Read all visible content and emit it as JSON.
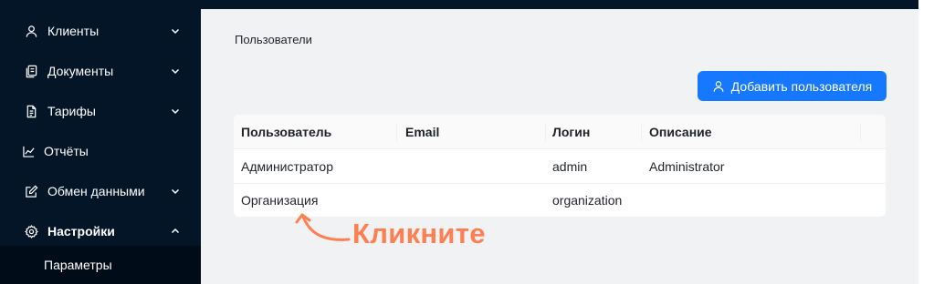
{
  "sidebar": {
    "items": [
      {
        "label": "Клиенты",
        "icon": "user-icon"
      },
      {
        "label": "Документы",
        "icon": "documents-icon"
      },
      {
        "label": "Тарифы",
        "icon": "tariff-icon"
      },
      {
        "label": "Отчёты",
        "icon": "chart-icon"
      },
      {
        "label": "Обмен данными",
        "icon": "edit-icon"
      },
      {
        "label": "Настройки",
        "icon": "gear-icon"
      }
    ],
    "sub_item": {
      "label": "Параметры"
    }
  },
  "page": {
    "title": "Пользователи",
    "add_button": "Добавить пользователя"
  },
  "table": {
    "columns": [
      "Пользователь",
      "Email",
      "Логин",
      "Описание"
    ],
    "rows": [
      {
        "user": "Администратор",
        "email": "",
        "login": "admin",
        "description": "Administrator"
      },
      {
        "user": "Организация",
        "email": "",
        "login": "organization",
        "description": ""
      }
    ]
  },
  "annotation": {
    "text": "Кликните",
    "color": "#ff7f50"
  },
  "colors": {
    "sidebar_bg": "#041528",
    "accent": "#1677ff",
    "page_bg": "#f1f2f4"
  }
}
